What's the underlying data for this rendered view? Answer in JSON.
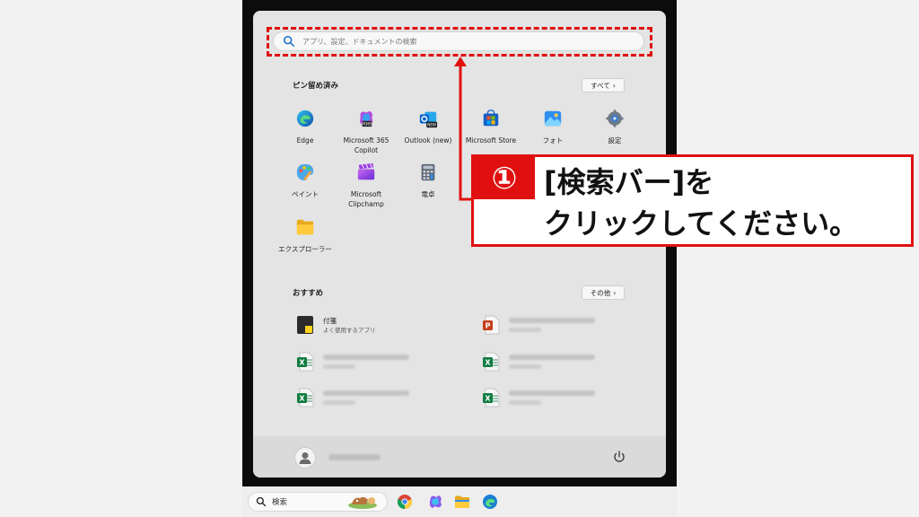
{
  "search": {
    "placeholder": "アプリ、設定、ドキュメントの検索"
  },
  "pinned": {
    "title": "ピン留め済み",
    "all_button": "すべて",
    "apps": [
      {
        "label": "Edge",
        "icon": "edge-icon"
      },
      {
        "label": "Microsoft 365 Copilot",
        "icon": "m365-copilot-icon",
        "badge": "M365"
      },
      {
        "label": "Outlook (new)",
        "icon": "outlook-icon",
        "badge": "NEW"
      },
      {
        "label": "Microsoft Store",
        "icon": "store-icon"
      },
      {
        "label": "フォト",
        "icon": "photos-icon"
      },
      {
        "label": "設定",
        "icon": "settings-gear-icon"
      },
      {
        "label": "ペイント",
        "icon": "paint-icon"
      },
      {
        "label": "Microsoft Clipchamp",
        "icon": "clipchamp-icon"
      },
      {
        "label": "電卓",
        "icon": "calculator-icon"
      },
      {
        "label": "エクスプローラー",
        "icon": "folder-icon"
      }
    ]
  },
  "recommended": {
    "title": "おすすめ",
    "other_button": "その他",
    "items": [
      {
        "title": "付箋",
        "subtitle": "よく使用するアプリ",
        "icon": "sticky-notes-icon"
      },
      {
        "title": "",
        "subtitle": "",
        "icon": "powerpoint-file-icon"
      },
      {
        "title": "",
        "subtitle": "",
        "icon": "excel-file-icon"
      },
      {
        "title": "",
        "subtitle": "",
        "icon": "excel-file-icon"
      },
      {
        "title": "",
        "subtitle": "",
        "icon": "excel-file-icon"
      },
      {
        "title": "",
        "subtitle": "",
        "icon": "excel-file-icon"
      }
    ]
  },
  "taskbar": {
    "search_label": "検索"
  },
  "callout": {
    "number": "①",
    "line1": "[検索バー]を",
    "line2": "クリックしてください。"
  },
  "colors": {
    "accent_red": "#e01010",
    "menu_bg": "#e4e4e4"
  }
}
